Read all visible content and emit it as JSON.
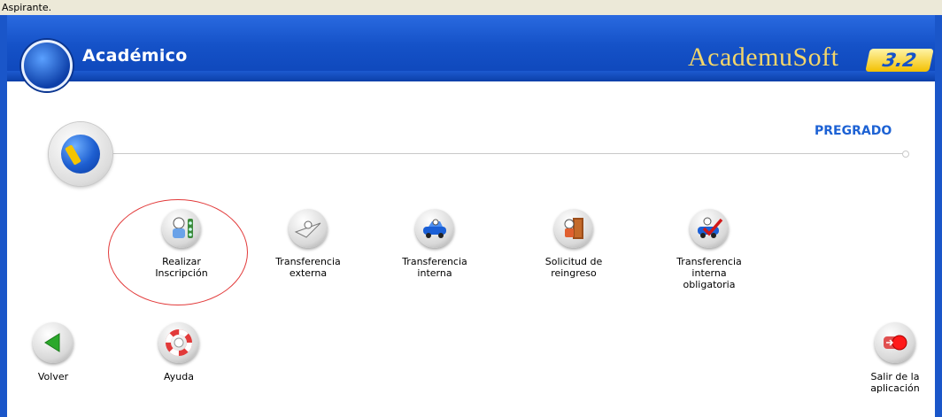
{
  "window": {
    "title": "Aspirante."
  },
  "header": {
    "title": "Académico",
    "brand": "AcademuSoft",
    "version": "3.2",
    "brand_color": "#f3d66a"
  },
  "section": {
    "label": "PREGRADO"
  },
  "tools": [
    {
      "label_1": "Realizar",
      "label_2": "Inscripción",
      "label_3": "",
      "icon": "inscription-icon"
    },
    {
      "label_1": "Transferencia",
      "label_2": "externa",
      "label_3": "",
      "icon": "paper-plane-icon"
    },
    {
      "label_1": "Transferencia",
      "label_2": "interna",
      "label_3": "",
      "icon": "car-icon"
    },
    {
      "label_1": "Solicitud de",
      "label_2": "reingreso",
      "label_3": "",
      "icon": "door-icon"
    },
    {
      "label_1": "Transferencia",
      "label_2": "interna",
      "label_3": "obligatoria",
      "icon": "checkmark-car-icon"
    }
  ],
  "nav": {
    "back": {
      "label": "Volver",
      "icon": "back-arrow-icon"
    },
    "help": {
      "label": "Ayuda",
      "icon": "lifebuoy-icon"
    },
    "exit": {
      "label_1": "Salir de la",
      "label_2": "aplicación",
      "icon": "exit-icon"
    }
  },
  "colors": {
    "header_blue": "#1552c8",
    "section_text": "#1d62d4",
    "highlight": "#e23a3a"
  }
}
